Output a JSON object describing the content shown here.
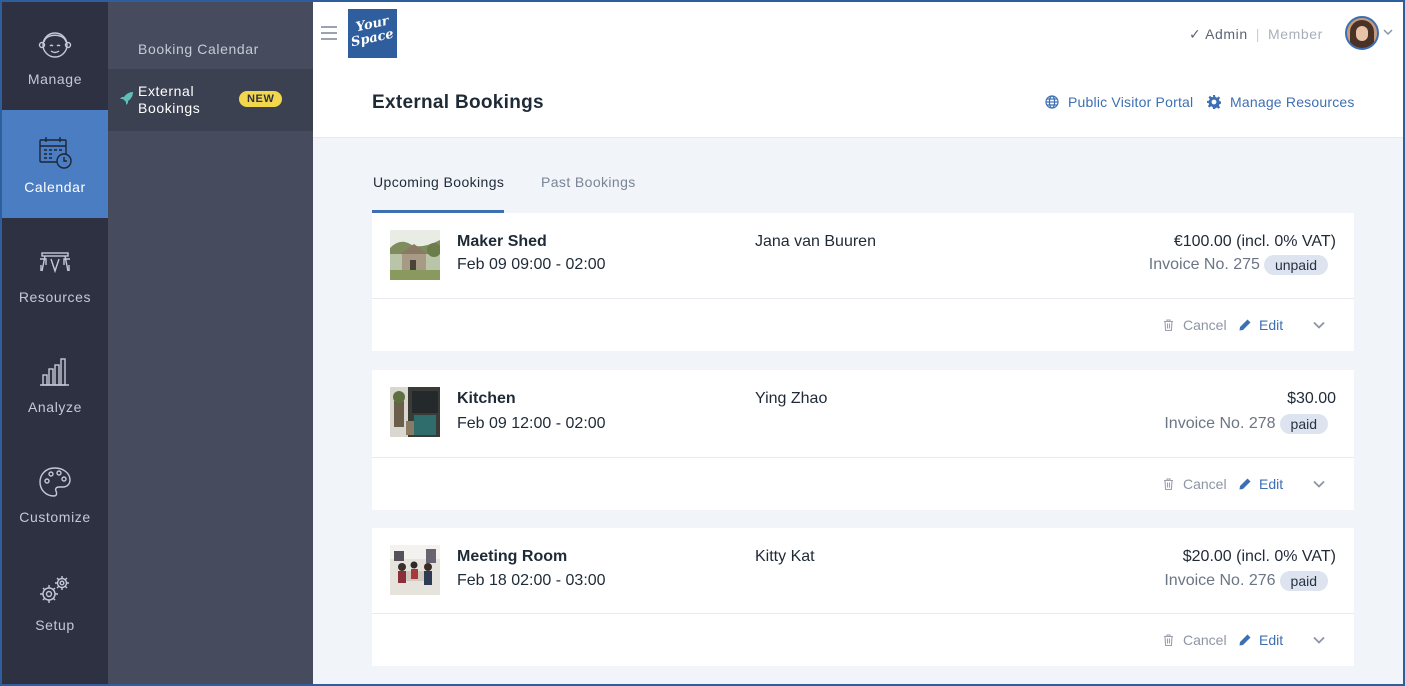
{
  "rail": {
    "items": [
      {
        "label": "Manage",
        "icon": "face-icon"
      },
      {
        "label": "Calendar",
        "icon": "calendar-clock-icon"
      },
      {
        "label": "Resources",
        "icon": "desk-icon"
      },
      {
        "label": "Analyze",
        "icon": "bar-chart-icon"
      },
      {
        "label": "Customize",
        "icon": "palette-icon"
      },
      {
        "label": "Setup",
        "icon": "gears-icon"
      }
    ]
  },
  "subnav": {
    "booking_calendar": "Booking Calendar",
    "external_bookings": "External Bookings",
    "new_badge": "NEW"
  },
  "header": {
    "logo_line1": "Your",
    "logo_line2": "Space",
    "role_admin": "Admin",
    "role_separator": "|",
    "role_member": "Member",
    "title": "External Bookings",
    "public_portal": "Public Visitor Portal",
    "manage_resources": "Manage Resources"
  },
  "tabs": {
    "upcoming": "Upcoming Bookings",
    "past": "Past Bookings"
  },
  "actions": {
    "cancel": "Cancel",
    "edit": "Edit"
  },
  "bookings": [
    {
      "resource": "Maker Shed",
      "time": "Feb 09 09:00 - 02:00",
      "guest": "Jana van Buuren",
      "price": "€100.00 (incl. 0% VAT)",
      "invoice": "Invoice No. 275",
      "status": "unpaid"
    },
    {
      "resource": "Kitchen",
      "time": "Feb 09 12:00 - 02:00",
      "guest": "Ying Zhao",
      "price": "$30.00",
      "invoice": "Invoice No. 278",
      "status": "paid"
    },
    {
      "resource": "Meeting Room",
      "time": "Feb 18 02:00 - 03:00",
      "guest": "Kitty Kat",
      "price": "$20.00 (incl. 0% VAT)",
      "invoice": "Invoice No. 276",
      "status": "paid"
    }
  ],
  "colors": {
    "rail_bg": "#2d3142",
    "subnav_bg": "#464c5e",
    "accent": "#4a7dc1",
    "link": "#3d6fb3",
    "badge": "#f2d64b"
  }
}
